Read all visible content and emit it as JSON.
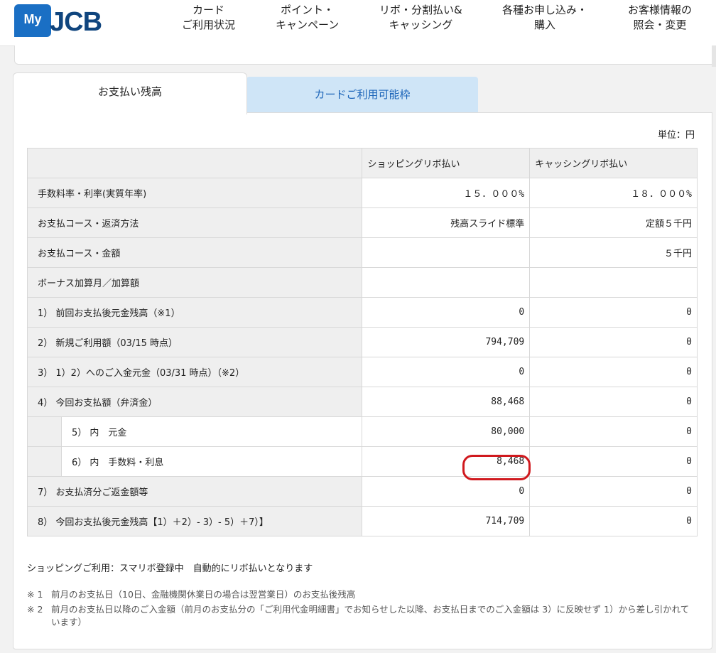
{
  "header": {
    "logo_my": "My",
    "logo_jcb": "JCB",
    "nav": [
      {
        "line1": "カード",
        "line2": "ご利用状況"
      },
      {
        "line1": "ポイント・",
        "line2": "キャンペーン"
      },
      {
        "line1": "リボ・分割払い&",
        "line2": "キャッシング"
      },
      {
        "line1": "各種お申し込み・",
        "line2": "購入"
      },
      {
        "line1": "お客様情報の",
        "line2": "照会・変更"
      }
    ]
  },
  "tabs": [
    {
      "label": "お支払い残高"
    },
    {
      "label": "カードご利用可能枠"
    }
  ],
  "unit_label": "単位：円",
  "table": {
    "columns": [
      "ショッピングリボ払い",
      "キャッシングリボ払い"
    ],
    "rows": [
      {
        "label": "手数料率・利率(実質年率)",
        "shopping": "１５．０００%",
        "cashing": "１８．０００%"
      },
      {
        "label": "お支払コース・返済方法",
        "shopping": "残高スライド標準",
        "cashing": "定額５千円"
      },
      {
        "label": "お支払コース・金額",
        "shopping": "",
        "cashing": "５千円"
      },
      {
        "label": "ボーナス加算月／加算額",
        "shopping": "",
        "cashing": ""
      },
      {
        "label": "1） 前回お支払後元金残高（※1）",
        "shopping": "0",
        "cashing": "0"
      },
      {
        "label": "2） 新規ご利用額（03/15 時点）",
        "shopping": "794,709",
        "cashing": "0"
      },
      {
        "label": "3） 1）2）へのご入金元金（03/31 時点）（※2）",
        "shopping": "0",
        "cashing": "0"
      },
      {
        "label": "4） 今回お支払額（弁済金）",
        "shopping": "88,468",
        "cashing": "0"
      },
      {
        "label": "5） 内　元金",
        "shopping": "80,000",
        "cashing": "0"
      },
      {
        "label": "6） 内　手数料・利息",
        "shopping": "8,468",
        "cashing": "0"
      },
      {
        "label": "7） お支払済分ご返金額等",
        "shopping": "0",
        "cashing": "0"
      },
      {
        "label": "8） 今回お支払後元金残高【1）＋2）- 3）- 5）＋7）】",
        "shopping": "714,709",
        "cashing": "0"
      }
    ]
  },
  "notes": {
    "main": "ショッピングご利用：スマリボ登録中　自動的にリボ払いとなります",
    "items": [
      {
        "mark": "※ 1",
        "text": "前月のお支払日（10日、金融機関休業日の場合は翌営業日）のお支払後残高"
      },
      {
        "mark": "※ 2",
        "text": "前月のお支払日以降のご入金額（前月のお支払分の「ご利用代金明細書」でお知らせした以降、お支払日までのご入金額は 3）に反映せず 1）から差し引かれています）"
      }
    ]
  },
  "colors": {
    "brand": "#10457e",
    "logo_bg": "#1a6fc4",
    "tab_inactive_bg": "#cfe5f7",
    "highlight": "#d0191e"
  }
}
